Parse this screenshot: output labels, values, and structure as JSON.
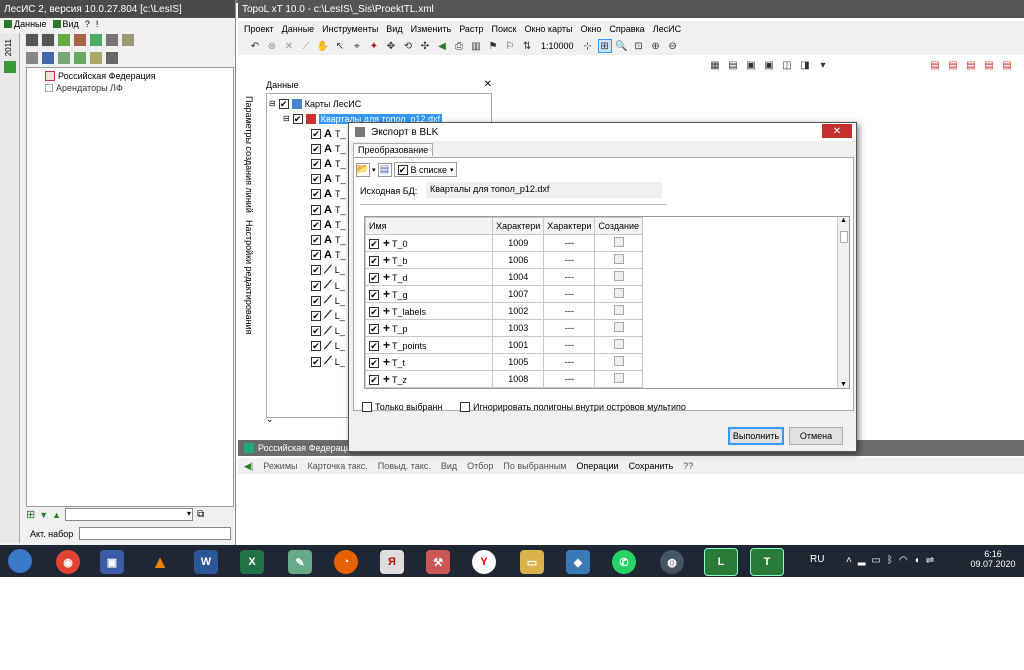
{
  "left_app": {
    "title": "ЛесИС 2, версия 10.0.27.804  [c:\\LesIS]",
    "menu": [
      "Данные",
      "Вид",
      "?",
      "!"
    ],
    "year_tab": "2011",
    "tree": [
      "Российская Федерация",
      "Арендаторы ЛФ"
    ],
    "bottom_label": "Акт. набор"
  },
  "main_app": {
    "title": "TopoL xT 10.0 - c:\\LesIS\\_Sis\\ProektTL.xml",
    "menu": [
      "Проект",
      "Данные",
      "Инструменты",
      "Вид",
      "Изменить",
      "Растр",
      "Поиск",
      "Окно карты",
      "Окно",
      "Справка",
      "ЛесИС"
    ],
    "scale": "1:10000",
    "side_labels": [
      "Параметры создания линий",
      "Настройки редактирования"
    ]
  },
  "data_panel": {
    "title": "Данные",
    "root": "Карты ЛесИС",
    "selected": "Кварталы для топол_p12.dxf",
    "children": [
      "T_",
      "T_",
      "T_",
      "T_",
      "T_",
      "T_",
      "T_",
      "T_",
      "T_",
      "L_",
      "L_",
      "L_",
      "L_",
      "L_",
      "L_",
      "L_"
    ]
  },
  "dialog": {
    "title": "Экспорт в BLK",
    "tab": "Преобразование",
    "in_list": "В списке",
    "source_label": "Исходная БД:",
    "source_value": "Кварталы для топол_p12.dxf",
    "columns": [
      "Имя",
      "Характери",
      "Характери",
      "Создание"
    ],
    "rows": [
      {
        "name": "T_0",
        "code": "1009",
        "char": "---"
      },
      {
        "name": "T_b",
        "code": "1006",
        "char": "---"
      },
      {
        "name": "T_d",
        "code": "1004",
        "char": "---"
      },
      {
        "name": "T_g",
        "code": "1007",
        "char": "---"
      },
      {
        "name": "T_labels",
        "code": "1002",
        "char": "---"
      },
      {
        "name": "T_p",
        "code": "1003",
        "char": "---"
      },
      {
        "name": "T_points",
        "code": "1001",
        "char": "---"
      },
      {
        "name": "T_t",
        "code": "1005",
        "char": "---"
      },
      {
        "name": "T_z",
        "code": "1008",
        "char": "---"
      }
    ],
    "only_selected": "Только выбранн",
    "ignore_polygons": "Игнорировать полигоны внутри островов мультипо",
    "run": "Выполнить",
    "cancel": "Отмена"
  },
  "bottom_panel": {
    "title": "Российская Федерация",
    "toolbar": [
      "Режимы",
      "Карточка такс.",
      "Повыд. такс.",
      "Вид",
      "Отбор",
      "По выбранным",
      "Операции",
      "Сохранить",
      "??"
    ]
  },
  "taskbar": {
    "lang": "RU",
    "time": "6:16",
    "date": "09.07.2020"
  }
}
